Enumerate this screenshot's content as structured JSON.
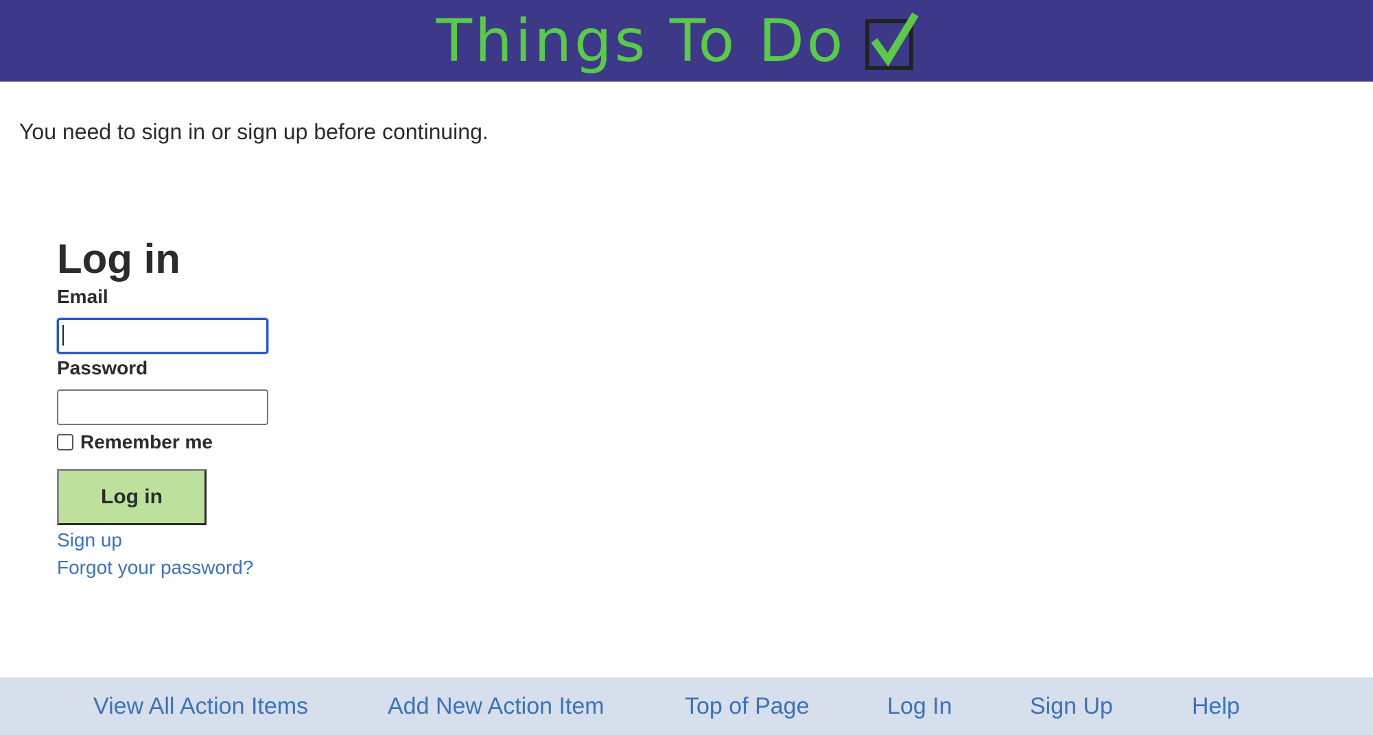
{
  "header": {
    "title": "Things To Do",
    "icon": "checkbox-check-icon",
    "background": "#3d3988",
    "title_color": "#5bc94a"
  },
  "flash": {
    "message": "You need to sign in or sign up before continuing."
  },
  "login": {
    "heading": "Log in",
    "email_label": "Email",
    "email_value": "",
    "password_label": "Password",
    "password_value": "",
    "remember_label": "Remember me",
    "remember_checked": false,
    "submit_label": "Log in",
    "button_color": "#bde19c",
    "signup_link": "Sign up",
    "forgot_link": "Forgot your password?"
  },
  "footer": {
    "background": "#d7dfec",
    "link_color": "#3c72b8",
    "links": [
      "View All Action Items",
      "Add New Action Item",
      "Top of Page",
      "Log In",
      "Sign Up",
      "Help"
    ]
  }
}
